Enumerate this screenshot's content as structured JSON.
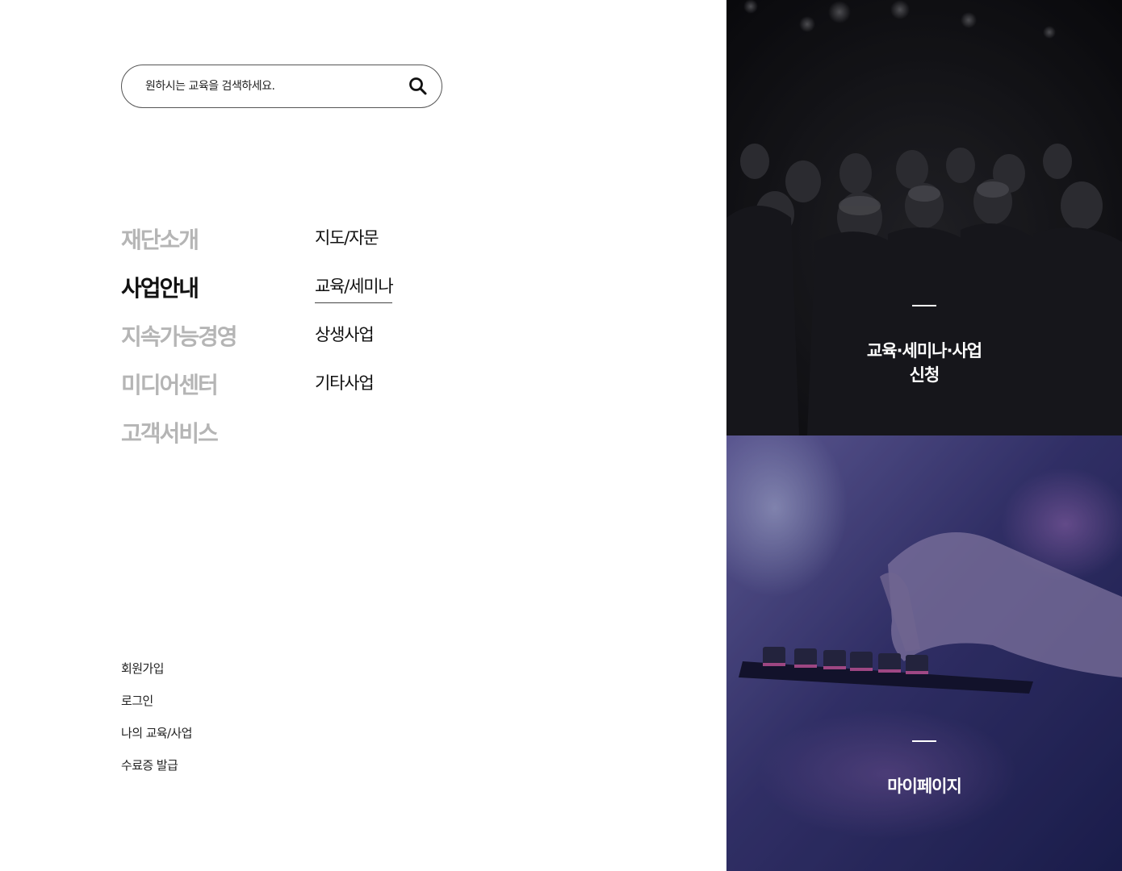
{
  "search": {
    "placeholder": "원하시는 교육을 검색하세요."
  },
  "main_menu": [
    {
      "label": "재단소개",
      "active": false
    },
    {
      "label": "사업안내",
      "active": true
    },
    {
      "label": "지속가능경영",
      "active": false
    },
    {
      "label": "미디어센터",
      "active": false
    },
    {
      "label": "고객서비스",
      "active": false
    }
  ],
  "sub_menu": [
    {
      "label": "지도/자문",
      "active": false
    },
    {
      "label": "교육/세미나",
      "active": true
    },
    {
      "label": "상생사업",
      "active": false
    },
    {
      "label": "기타사업",
      "active": false
    }
  ],
  "util_links": [
    {
      "label": "회원가입"
    },
    {
      "label": "로그인"
    },
    {
      "label": "나의 교육/사업"
    },
    {
      "label": "수료증 발급"
    }
  ],
  "panels": {
    "apply": {
      "line1": "교육·세미나·사업",
      "line2": "신청",
      "image_icon": "seminar-audience-photo"
    },
    "mypage": {
      "label": "마이페이지",
      "image_icon": "keyboard-typing-photo"
    }
  },
  "colors": {
    "inactive_menu": "#b5b5b5",
    "active_menu": "#111111",
    "panel_text": "#ffffff",
    "top_panel_bg": "#141418",
    "bottom_panel_bg": "#2a2a5c"
  }
}
